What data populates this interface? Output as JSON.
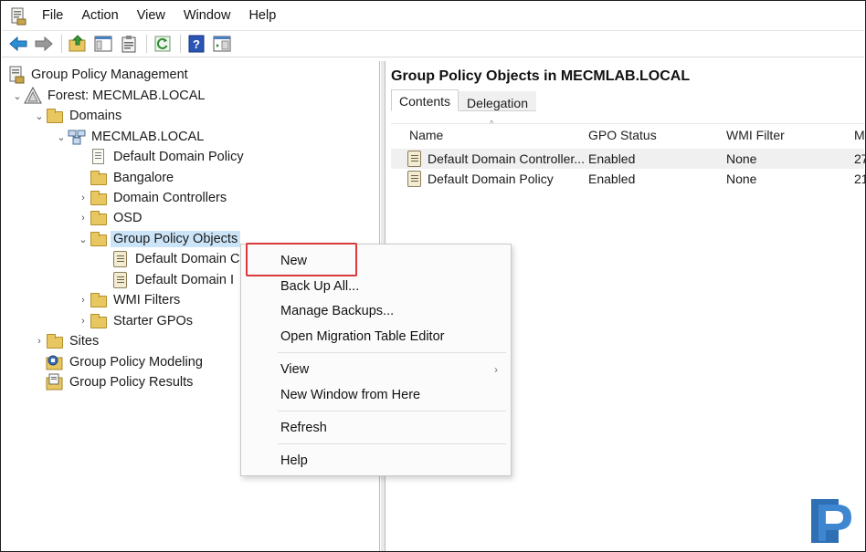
{
  "menubar": {
    "items": [
      "File",
      "Action",
      "View",
      "Window",
      "Help"
    ]
  },
  "toolbar": {
    "buttons": [
      "back-icon",
      "forward-icon",
      "up-folder-icon",
      "show-hide-tree-icon",
      "clipboard-icon",
      "refresh-icon",
      "help-icon",
      "console-icon"
    ]
  },
  "tree": {
    "root": "Group Policy Management",
    "forest": "Forest: MECMLAB.LOCAL",
    "domains": "Domains",
    "domain": "MECMLAB.LOCAL",
    "default_domain_policy": "Default Domain Policy",
    "bangalore": "Bangalore",
    "domain_controllers": "Domain Controllers",
    "osd": "OSD",
    "gpo": "Group Policy Objects",
    "gpo_child_1": "Default Domain C",
    "gpo_child_2": "Default Domain I",
    "wmi_filters": "WMI Filters",
    "starter_gpos": "Starter GPOs",
    "sites": "Sites",
    "modeling": "Group Policy Modeling",
    "results": "Group Policy Results"
  },
  "right": {
    "title": "Group Policy Objects in MECMLAB.LOCAL",
    "tabs": [
      "Contents",
      "Delegation"
    ],
    "columns": [
      "Name",
      "GPO Status",
      "WMI Filter",
      "M"
    ],
    "rows": [
      {
        "name": "Default Domain Controller...",
        "status": "Enabled",
        "wmi": "None",
        "m": "27"
      },
      {
        "name": "Default Domain Policy",
        "status": "Enabled",
        "wmi": "None",
        "m": "21"
      }
    ]
  },
  "context_menu": {
    "new": "New",
    "backup_all": "Back Up All...",
    "manage_backups": "Manage Backups...",
    "migration": "Open Migration Table Editor",
    "view": "View",
    "new_window": "New Window from Here",
    "refresh": "Refresh",
    "help": "Help"
  },
  "colors": {
    "highlight_box": "#d93a3a",
    "selection": "#cce4f7",
    "logo": "#2f6fb3"
  }
}
